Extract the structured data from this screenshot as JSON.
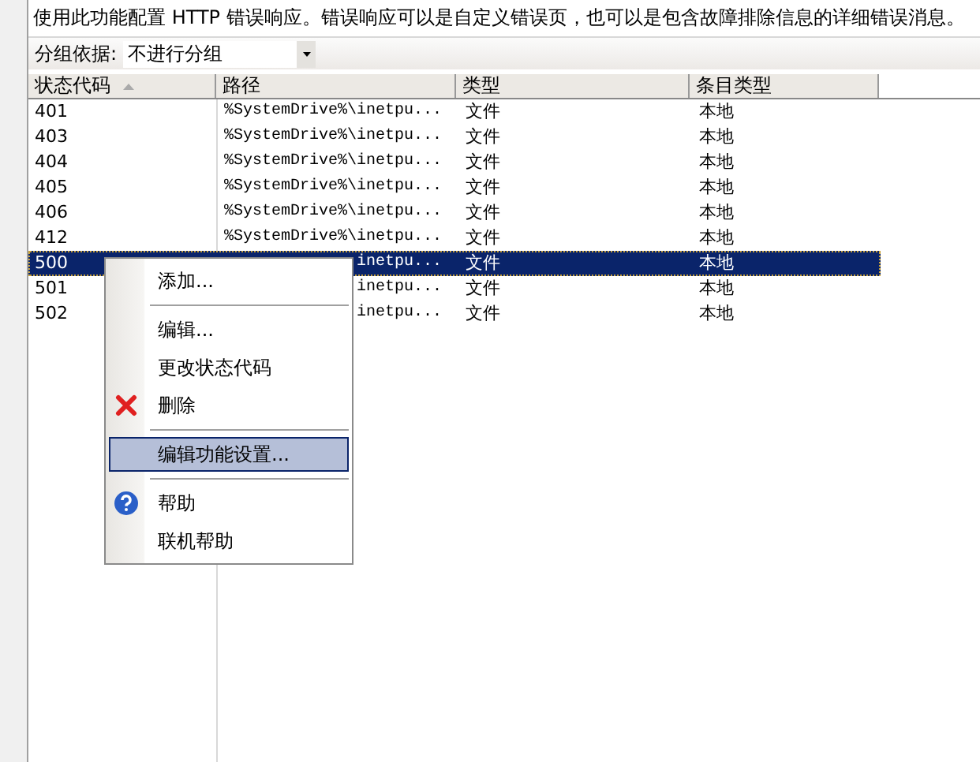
{
  "description": "使用此功能配置 HTTP 错误响应。错误响应可以是自定义错误页，也可以是包含故障排除信息的详细错误消息。",
  "group_by": {
    "label": "分组依据:",
    "value": "不进行分组"
  },
  "table": {
    "columns": [
      {
        "label": "状态代码",
        "sorted": true
      },
      {
        "label": "路径",
        "sorted": false
      },
      {
        "label": "类型",
        "sorted": false
      },
      {
        "label": "条目类型",
        "sorted": false
      }
    ],
    "rows": [
      {
        "code": "401",
        "path": "%SystemDrive%\\inetpu...",
        "type": "文件",
        "entry_type": "本地",
        "selected": false
      },
      {
        "code": "403",
        "path": "%SystemDrive%\\inetpu...",
        "type": "文件",
        "entry_type": "本地",
        "selected": false
      },
      {
        "code": "404",
        "path": "%SystemDrive%\\inetpu...",
        "type": "文件",
        "entry_type": "本地",
        "selected": false
      },
      {
        "code": "405",
        "path": "%SystemDrive%\\inetpu...",
        "type": "文件",
        "entry_type": "本地",
        "selected": false
      },
      {
        "code": "406",
        "path": "%SystemDrive%\\inetpu...",
        "type": "文件",
        "entry_type": "本地",
        "selected": false
      },
      {
        "code": "412",
        "path": "%SystemDrive%\\inetpu...",
        "type": "文件",
        "entry_type": "本地",
        "selected": false
      },
      {
        "code": "500",
        "path": "inetpu...",
        "type": "文件",
        "entry_type": "本地",
        "selected": true
      },
      {
        "code": "501",
        "path": "inetpu...",
        "type": "文件",
        "entry_type": "本地",
        "selected": false
      },
      {
        "code": "502",
        "path": "inetpu...",
        "type": "文件",
        "entry_type": "本地",
        "selected": false
      }
    ]
  },
  "context_menu": [
    {
      "kind": "item",
      "label": "添加...",
      "selected": false
    },
    {
      "kind": "separator"
    },
    {
      "kind": "item",
      "label": "编辑...",
      "selected": false
    },
    {
      "kind": "item",
      "label": "更改状态代码",
      "selected": false
    },
    {
      "kind": "delete",
      "label": "删除",
      "selected": false
    },
    {
      "kind": "separator"
    },
    {
      "kind": "item",
      "label": "编辑功能设置...",
      "selected": true
    },
    {
      "kind": "separator"
    },
    {
      "kind": "help",
      "label": "帮助",
      "selected": false
    },
    {
      "kind": "item",
      "label": "联机帮助",
      "selected": false
    }
  ]
}
